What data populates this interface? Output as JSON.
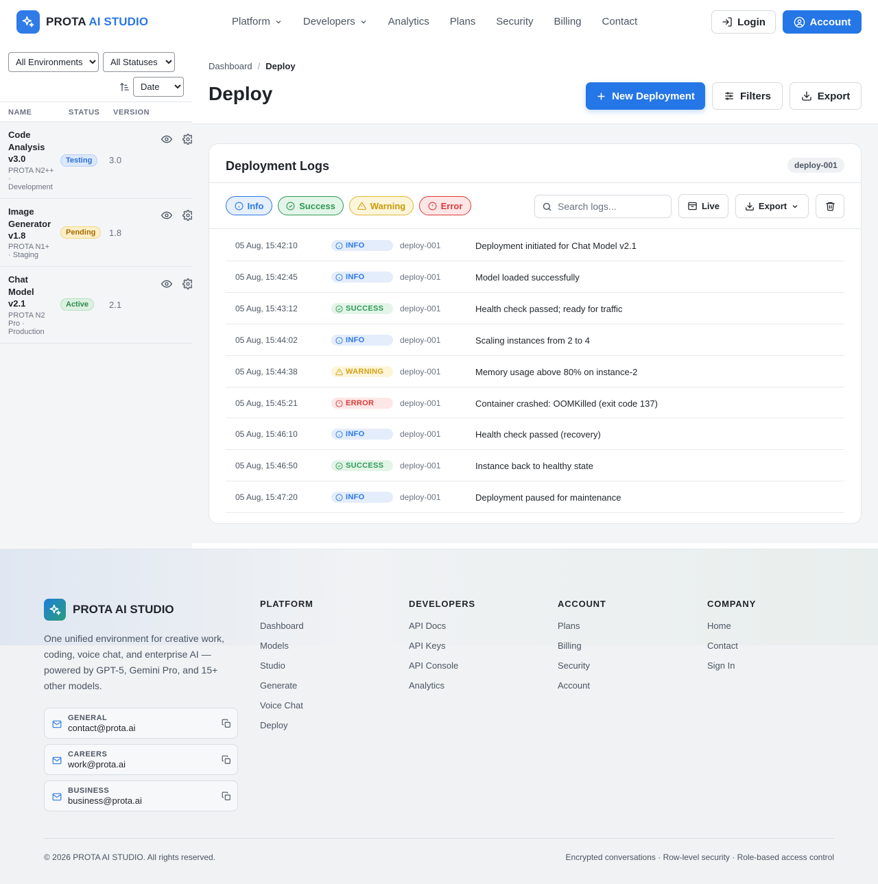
{
  "brand": {
    "name_prefix": "PROTA",
    "name_accent": "AI STUDIO"
  },
  "nav": {
    "links": [
      "Platform",
      "Developers",
      "Analytics",
      "Plans",
      "Security",
      "Billing",
      "Contact"
    ],
    "login_label": "Login",
    "account_label": "Account"
  },
  "sidebar": {
    "env_filter": "All Environments",
    "status_filter": "All Statuses",
    "sort_by": "Date",
    "columns": [
      "NAME",
      "STATUS",
      "VERSION"
    ],
    "models": [
      {
        "name": "Code Analysis v3.0",
        "meta": "PROTA N2++ · Development",
        "status": "Testing",
        "version": "3.0"
      },
      {
        "name": "Image Generator v1.8",
        "meta": "PROTA N1+ · Staging",
        "status": "Pending",
        "version": "1.8"
      },
      {
        "name": "Chat Model v2.1",
        "meta": "PROTA N2 Pro · Production",
        "status": "Active",
        "version": "2.1"
      }
    ]
  },
  "header": {
    "breadcrumb": [
      "Dashboard",
      "Deploy"
    ],
    "title": "Deploy",
    "new_deployment_label": "New Deployment",
    "filters_label": "Filters",
    "export_label": "Export"
  },
  "logs": {
    "title": "Deployment Logs",
    "deploy_id": "deploy-001",
    "chips": [
      "Info",
      "Success",
      "Warning",
      "Error"
    ],
    "search_placeholder": "Search logs...",
    "live_label": "Live",
    "export_label": "Export",
    "rows": [
      {
        "time": "05 Aug, 15:42:10",
        "level": "INFO",
        "source": "deploy-001",
        "message": "Deployment initiated for Chat Model v2.1"
      },
      {
        "time": "05 Aug, 15:42:45",
        "level": "INFO",
        "source": "deploy-001",
        "message": "Model loaded successfully"
      },
      {
        "time": "05 Aug, 15:43:12",
        "level": "SUCCESS",
        "source": "deploy-001",
        "message": "Health check passed; ready for traffic"
      },
      {
        "time": "05 Aug, 15:44:02",
        "level": "INFO",
        "source": "deploy-001",
        "message": "Scaling instances from 2 to 4"
      },
      {
        "time": "05 Aug, 15:44:38",
        "level": "WARNING",
        "source": "deploy-001",
        "message": "Memory usage above 80% on instance-2"
      },
      {
        "time": "05 Aug, 15:45:21",
        "level": "ERROR",
        "source": "deploy-001",
        "message": "Container crashed: OOMKilled (exit code 137)"
      },
      {
        "time": "05 Aug, 15:46:10",
        "level": "INFO",
        "source": "deploy-001",
        "message": "Health check passed (recovery)"
      },
      {
        "time": "05 Aug, 15:46:50",
        "level": "SUCCESS",
        "source": "deploy-001",
        "message": "Instance back to healthy state"
      },
      {
        "time": "05 Aug, 15:47:20",
        "level": "INFO",
        "source": "deploy-001",
        "message": "Deployment paused for maintenance"
      }
    ]
  },
  "footer": {
    "brand_name": "PROTA AI STUDIO",
    "description": "One unified environment for creative work, coding, voice chat, and enterprise AI — powered by GPT-5, Gemini Pro, and 15+ other models.",
    "contacts": [
      {
        "label": "GENERAL",
        "email": "contact@prota.ai"
      },
      {
        "label": "CAREERS",
        "email": "work@prota.ai"
      },
      {
        "label": "BUSINESS",
        "email": "business@prota.ai"
      }
    ],
    "columns": [
      {
        "title": "PLATFORM",
        "links": [
          "Dashboard",
          "Models",
          "Studio",
          "Generate",
          "Voice Chat",
          "Deploy"
        ]
      },
      {
        "title": "DEVELOPERS",
        "links": [
          "API Docs",
          "API Keys",
          "API Console",
          "Analytics"
        ]
      },
      {
        "title": "ACCOUNT",
        "links": [
          "Plans",
          "Billing",
          "Security",
          "Account"
        ]
      },
      {
        "title": "COMPANY",
        "links": [
          "Home",
          "Contact",
          "Sign In"
        ]
      }
    ],
    "copyright": "© 2026 PROTA AI STUDIO. All rights reserved.",
    "security_note": "Encrypted conversations · Row-level security · Role-based access control"
  },
  "colors": {
    "accent": "#2576e6",
    "info": "#2b78e4",
    "success": "#2e9a55",
    "warning": "#d4a017",
    "error": "#d93a3a"
  }
}
